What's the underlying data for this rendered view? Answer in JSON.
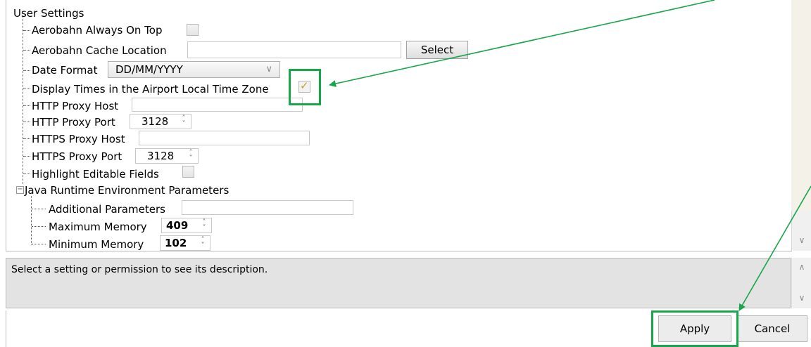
{
  "tree": {
    "section_title": "User Settings",
    "items": [
      {
        "label": "Aerobahn Always On Top"
      },
      {
        "label": "Aerobahn Cache Location"
      },
      {
        "label": "Date Format"
      },
      {
        "label": "Display Times in the Airport Local Time Zone"
      },
      {
        "label": "HTTP Proxy Host"
      },
      {
        "label": "HTTP Proxy Port"
      },
      {
        "label": "HTTPS Proxy Host"
      },
      {
        "label": "HTTPS Proxy Port"
      },
      {
        "label": "Highlight Editable Fields"
      }
    ],
    "group": {
      "label": "Java Runtime Environment Parameters",
      "expander": "−",
      "items": [
        {
          "label": "Additional Parameters"
        },
        {
          "label": "Maximum Memory"
        },
        {
          "label": "Minimum Memory"
        }
      ]
    }
  },
  "values": {
    "select_button": "Select",
    "date_format": "DD/MM/YYYY",
    "local_time_checked": true,
    "http_proxy_port": "3128",
    "https_proxy_port": "3128",
    "max_memory": "409",
    "min_memory": "102"
  },
  "description": "Select a setting or permission to see its description.",
  "buttons": {
    "apply": "Apply",
    "cancel": "Cancel"
  },
  "colors": {
    "highlight": "#19a64a",
    "arrow": "#19a64a",
    "check": "#c9a227"
  }
}
